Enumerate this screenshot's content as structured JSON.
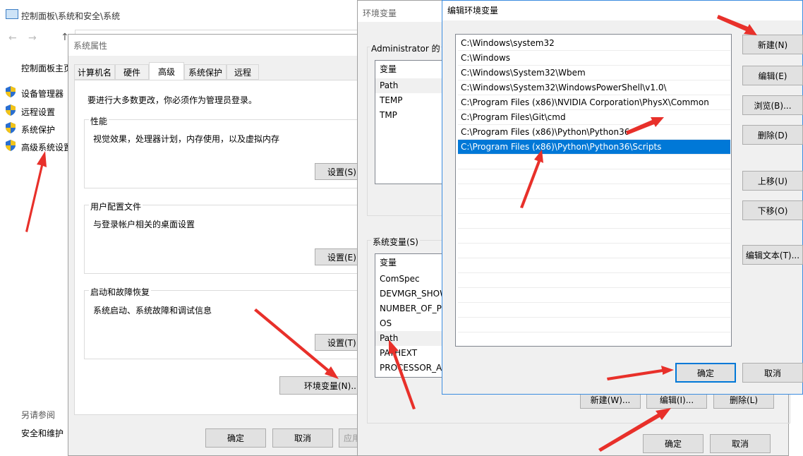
{
  "control_panel": {
    "title": "控制面板\\系统和安全\\系统",
    "nav_home": "控制面板主页",
    "links": [
      "设备管理器",
      "远程设置",
      "系统保护",
      "高级系统设置"
    ],
    "see_also_title": "另请参阅",
    "see_also_link": "安全和维护"
  },
  "system_properties": {
    "title": "系统属性",
    "tabs": [
      "计算机名",
      "硬件",
      "高级",
      "系统保护",
      "远程"
    ],
    "active_tab": "高级",
    "admin_note": "要进行大多数更改，你必须作为管理员登录。",
    "performance": {
      "label": "性能",
      "desc": "视觉效果，处理器计划，内存使用，以及虚拟内存",
      "button": "设置(S)..."
    },
    "profile": {
      "label": "用户配置文件",
      "desc": "与登录帐户相关的桌面设置",
      "button": "设置(E)..."
    },
    "startup": {
      "label": "启动和故障恢复",
      "desc": "系统启动、系统故障和调试信息",
      "button": "设置(T)..."
    },
    "env_button": "环境变量(N)...",
    "ok": "确定",
    "cancel": "取消",
    "apply": "应用(A)"
  },
  "env_vars": {
    "title": "环境变量",
    "user_group": "Administrator 的用户变量(U)",
    "user_header": "变量",
    "user_rows": [
      "Path",
      "TEMP",
      "TMP"
    ],
    "sys_group": "系统变量(S)",
    "sys_header": "变量",
    "sys_rows": [
      "ComSpec",
      "DEVMGR_SHOW_DETAILS",
      "NUMBER_OF_PROCESSORS",
      "OS",
      "Path",
      "PATHEXT",
      "PROCESSOR_ARCHITECTURE"
    ],
    "new_button": "新建(W)...",
    "edit_button": "编辑(I)...",
    "delete_button": "删除(L)",
    "ok": "确定",
    "cancel": "取消"
  },
  "edit_env": {
    "title": "编辑环境变量",
    "entries": [
      "C:\\Windows\\system32",
      "C:\\Windows",
      "C:\\Windows\\System32\\Wbem",
      "C:\\Windows\\System32\\WindowsPowerShell\\v1.0\\",
      "C:\\Program Files (x86)\\NVIDIA Corporation\\PhysX\\Common",
      "C:\\Program Files\\Git\\cmd",
      "C:\\Program Files (x86)\\Python\\Python36",
      "C:\\Program Files (x86)\\Python\\Python36\\Scripts"
    ],
    "selected_index": 7,
    "buttons": {
      "new": "新建(N)",
      "edit": "编辑(E)",
      "browse": "浏览(B)...",
      "delete": "删除(D)",
      "move_up": "上移(U)",
      "move_down": "下移(O)",
      "edit_text": "编辑文本(T)..."
    },
    "ok": "确定",
    "cancel": "取消"
  },
  "colors": {
    "selection": "#0078d7",
    "arrow": "#e8302a",
    "dialog_bg": "#f0f0f0"
  }
}
